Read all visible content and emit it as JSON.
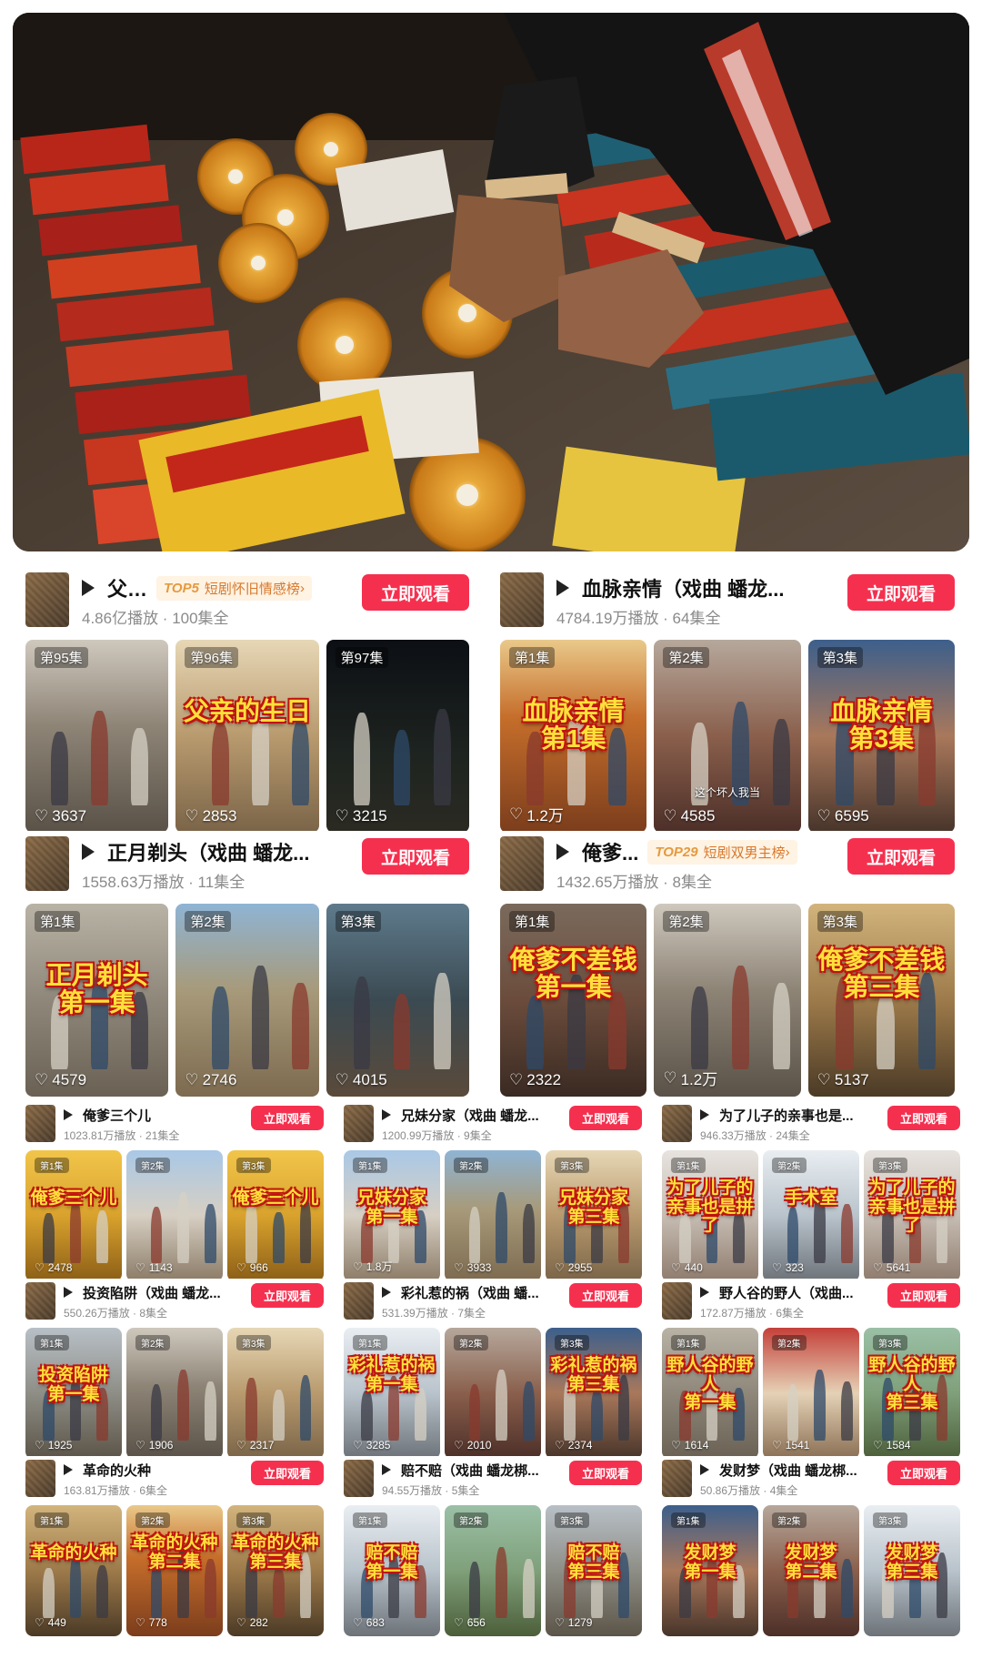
{
  "hero": {
    "alt": ""
  },
  "cards": [
    {
      "id": "c1",
      "title": "父…",
      "rank_tag": "TOP5",
      "rank_text": "短剧怀旧情感榜",
      "meta": "4.86亿播放 · 100集全",
      "button": "立即观看",
      "episodes": [
        {
          "label": "第95集",
          "likes": "3637",
          "scene": "s-room",
          "overlay": ""
        },
        {
          "label": "第96集",
          "likes": "2853",
          "scene": "s-yard",
          "overlay": "父亲的生日"
        },
        {
          "label": "第97集",
          "likes": "3215",
          "scene": "s-night",
          "overlay": ""
        }
      ]
    },
    {
      "id": "c2",
      "title": "血脉亲情（戏曲 蟠龙...",
      "rank_tag": "",
      "rank_text": "",
      "meta": "4784.19万播放 · 64集全",
      "button": "立即观看",
      "episodes": [
        {
          "label": "第1集",
          "likes": "1.2万",
          "scene": "s-temple",
          "overlay": "血脉亲情\n第1集"
        },
        {
          "label": "第2集",
          "likes": "4585",
          "scene": "s-face",
          "overlay": "",
          "sub": "这个坏人我当"
        },
        {
          "label": "第3集",
          "likes": "6595",
          "scene": "s-face2",
          "overlay": "血脉亲情\n第3集"
        }
      ]
    },
    {
      "id": "c3",
      "title": "正月剃头（戏曲 蟠龙...",
      "rank_tag": "",
      "rank_text": "",
      "meta": "1558.63万播放 · 11集全",
      "button": "立即观看",
      "episodes": [
        {
          "label": "第1集",
          "likes": "4579",
          "scene": "s-wall",
          "overlay": "正月剃头\n第一集"
        },
        {
          "label": "第2集",
          "likes": "2746",
          "scene": "s-field",
          "overlay": ""
        },
        {
          "label": "第3集",
          "likes": "4015",
          "scene": "s-village",
          "overlay": ""
        }
      ]
    },
    {
      "id": "c4",
      "title": "俺爹...",
      "rank_tag": "TOP29",
      "rank_text": "短剧双男主榜",
      "meta": "1432.65万播放 · 8集全",
      "button": "立即观看",
      "episodes": [
        {
          "label": "第1集",
          "likes": "2322",
          "scene": "s-old",
          "overlay": "俺爹不差钱\n第一集"
        },
        {
          "label": "第2集",
          "likes": "1.2万",
          "scene": "s-room",
          "overlay": ""
        },
        {
          "label": "第3集",
          "likes": "5137",
          "scene": "s-stage",
          "overlay": "俺爹不差钱\n第三集"
        }
      ]
    },
    {
      "id": "c5",
      "title": "俺爹三个儿",
      "rank_tag": "",
      "rank_text": "",
      "meta": "1023.81万播放 · 21集全",
      "button": "立即观看",
      "episodes": [
        {
          "label": "第1集",
          "likes": "2478",
          "scene": "s-wheat",
          "overlay": "俺爹三个儿"
        },
        {
          "label": "第2集",
          "likes": "1143",
          "scene": "s-spring",
          "overlay": ""
        },
        {
          "label": "第3集",
          "likes": "966",
          "scene": "s-wheat",
          "overlay": "俺爹三个儿"
        }
      ]
    },
    {
      "id": "c6",
      "title": "兄妹分家（戏曲 蟠龙...",
      "rank_tag": "",
      "rank_text": "",
      "meta": "1200.99万播放 · 9集全",
      "button": "立即观看",
      "episodes": [
        {
          "label": "第1集",
          "likes": "1.8万",
          "scene": "s-spring",
          "overlay": "兄妹分家\n第一集"
        },
        {
          "label": "第2集",
          "likes": "3933",
          "scene": "s-field",
          "overlay": ""
        },
        {
          "label": "第3集",
          "likes": "2955",
          "scene": "s-yard",
          "overlay": "兄妹分家\n第三集"
        }
      ]
    },
    {
      "id": "c7",
      "title": "为了儿子的亲事也是...",
      "rank_tag": "",
      "rank_text": "",
      "meta": "946.33万播放 · 24集全",
      "button": "立即观看",
      "episodes": [
        {
          "label": "第1集",
          "likes": "440",
          "scene": "s-office",
          "overlay": "为了儿子的\n亲事也是拼了"
        },
        {
          "label": "第2集",
          "likes": "323",
          "scene": "s-white",
          "overlay": "手术室"
        },
        {
          "label": "第3集",
          "likes": "5641",
          "scene": "s-office",
          "overlay": "为了儿子的\n亲事也是拼了"
        }
      ]
    },
    {
      "id": "c8",
      "title": "投资陷阱（戏曲 蟠龙...",
      "rank_tag": "",
      "rank_text": "",
      "meta": "550.26万播放 · 8集全",
      "button": "立即观看",
      "episodes": [
        {
          "label": "第1集",
          "likes": "1925",
          "scene": "s-street",
          "overlay": "投资陷阱\n第一集"
        },
        {
          "label": "第2集",
          "likes": "1906",
          "scene": "s-room",
          "overlay": ""
        },
        {
          "label": "第3集",
          "likes": "2317",
          "scene": "s-yard",
          "overlay": ""
        }
      ]
    },
    {
      "id": "c9",
      "title": "彩礼惹的祸（戏曲 蟠...",
      "rank_tag": "",
      "rank_text": "",
      "meta": "531.39万播放 · 7集全",
      "button": "立即观看",
      "episodes": [
        {
          "label": "第1集",
          "likes": "3285",
          "scene": "s-white",
          "overlay": "彩礼惹的祸\n第一集"
        },
        {
          "label": "第2集",
          "likes": "2010",
          "scene": "s-face",
          "overlay": ""
        },
        {
          "label": "第3集",
          "likes": "2374",
          "scene": "s-face2",
          "overlay": "彩礼惹的祸\n第三集"
        }
      ]
    },
    {
      "id": "c10",
      "title": "野人谷的野人（戏曲...",
      "rank_tag": "",
      "rank_text": "",
      "meta": "172.87万播放 · 6集全",
      "button": "立即观看",
      "episodes": [
        {
          "label": "第1集",
          "likes": "1614",
          "scene": "s-wall",
          "overlay": "野人谷的野人\n第一集"
        },
        {
          "label": "第2集",
          "likes": "1541",
          "scene": "s-red",
          "overlay": ""
        },
        {
          "label": "第3集",
          "likes": "1584",
          "scene": "s-green",
          "overlay": "野人谷的野人\n第三集"
        }
      ]
    },
    {
      "id": "c11",
      "title": "革命的火种",
      "rank_tag": "",
      "rank_text": "",
      "meta": "163.81万播放 · 6集全",
      "button": "立即观看",
      "episodes": [
        {
          "label": "第1集",
          "likes": "449",
          "scene": "s-stage",
          "overlay": "革命的火种"
        },
        {
          "label": "第2集",
          "likes": "778",
          "scene": "s-temple",
          "overlay": "革命的火种\n第二集"
        },
        {
          "label": "第3集",
          "likes": "282",
          "scene": "s-stage",
          "overlay": "革命的火种\n第三集"
        }
      ]
    },
    {
      "id": "c12",
      "title": "赔不赔（戏曲 蟠龙梆...",
      "rank_tag": "",
      "rank_text": "",
      "meta": "94.55万播放 · 5集全",
      "button": "立即观看",
      "episodes": [
        {
          "label": "第1集",
          "likes": "683",
          "scene": "s-white",
          "overlay": "赔不赔\n第一集"
        },
        {
          "label": "第2集",
          "likes": "656",
          "scene": "s-green",
          "overlay": ""
        },
        {
          "label": "第3集",
          "likes": "1279",
          "scene": "s-street",
          "overlay": "赔不赔\n第三集"
        }
      ]
    },
    {
      "id": "c13",
      "title": "发财梦（戏曲 蟠龙梆...",
      "rank_tag": "",
      "rank_text": "",
      "meta": "50.86万播放 · 4集全",
      "button": "立即观看",
      "episodes": [
        {
          "label": "第1集",
          "likes": "",
          "scene": "s-face2",
          "overlay": "发财梦\n第一集"
        },
        {
          "label": "第2集",
          "likes": "",
          "scene": "s-face",
          "overlay": "发财梦\n第二集"
        },
        {
          "label": "第3集",
          "likes": "",
          "scene": "s-white",
          "overlay": "发财梦\n第三集"
        }
      ]
    }
  ]
}
